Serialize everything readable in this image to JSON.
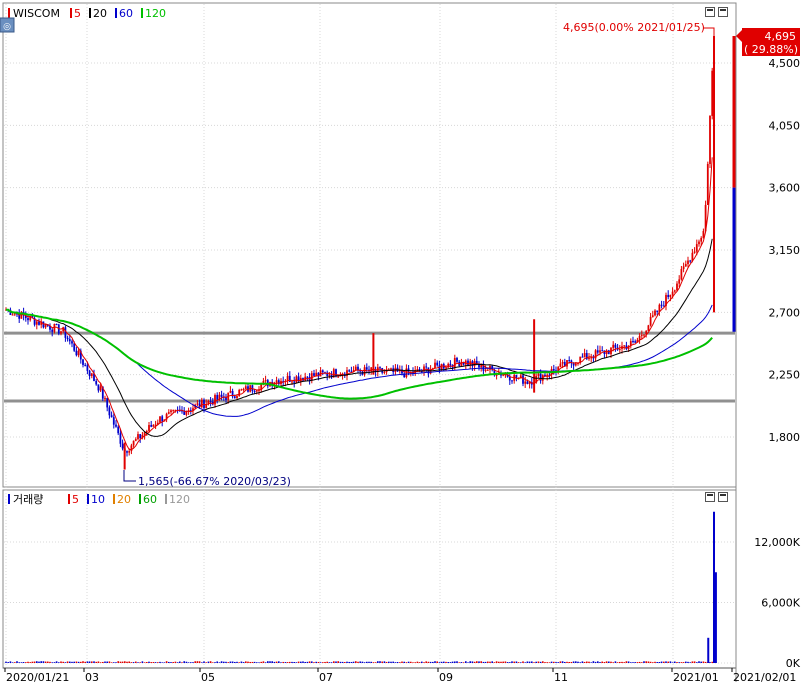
{
  "price_legend": {
    "symbol_icon": "red-bar-icon",
    "name": "WISCOM",
    "ma_items": [
      {
        "label": "5",
        "color": "#e00000"
      },
      {
        "label": "20",
        "color": "#000000"
      },
      {
        "label": "60",
        "color": "#0000cc"
      },
      {
        "label": "120",
        "color": "#00c000"
      }
    ]
  },
  "volume_legend": {
    "name": "거래량",
    "ma_items": [
      {
        "label": "5",
        "color": "#e00000"
      },
      {
        "label": "10",
        "color": "#0000cc"
      },
      {
        "label": "20",
        "color": "#e08000"
      },
      {
        "label": "60",
        "color": "#00a000"
      },
      {
        "label": "120",
        "color": "#999999"
      }
    ]
  },
  "annotations": {
    "max_note": "4,695(0.00% 2021/01/25)",
    "min_note": "1,565(-66.67% 2020/03/23)",
    "current_price": "4,695",
    "current_change": "( 29.88%)"
  },
  "chart_data": [
    {
      "type": "candlestick",
      "title": "WISCOM",
      "y_ticks": [
        "4,500",
        "4,050",
        "3,600",
        "3,150",
        "2,700",
        "2,250",
        "1,800"
      ],
      "ylim": [
        1570,
        4770
      ],
      "x_labels": [
        "2020/01/21",
        "03",
        "05",
        "07",
        "09",
        "11",
        "2021/01",
        "2021/02/01"
      ],
      "horizontal_lines": [
        2550,
        2060
      ],
      "key_points": [
        {
          "date": "2020/01/21",
          "close": 2720
        },
        {
          "date": "2020/02/20",
          "close": 2560
        },
        {
          "date": "2020/03/10",
          "close": 2150
        },
        {
          "date": "2020/03/23",
          "low": 1565,
          "close": 1700
        },
        {
          "date": "2020/04/10",
          "close": 1930
        },
        {
          "date": "2020/05/05",
          "close": 2050
        },
        {
          "date": "2020/06/10",
          "close": 2210
        },
        {
          "date": "2020/07/20",
          "close": 2280
        },
        {
          "date": "2020/08/20",
          "close": 2260
        },
        {
          "date": "2020/09/15",
          "close": 2350
        },
        {
          "date": "2020/10/20",
          "close": 2200
        },
        {
          "date": "2020/11/15",
          "close": 2360
        },
        {
          "date": "2020/12/15",
          "close": 2480
        },
        {
          "date": "2021/01/05",
          "close": 2900
        },
        {
          "date": "2021/01/20",
          "close": 3300
        },
        {
          "date": "2021/01/25",
          "high": 4695,
          "close": 4695
        }
      ],
      "moving_averages": [
        "5",
        "20",
        "60",
        "120"
      ],
      "grid": true
    },
    {
      "type": "bar",
      "title": "거래량",
      "y_ticks": [
        "12,000K",
        "6,000K",
        "0K"
      ],
      "ylim": [
        0,
        16000
      ],
      "spikes": [
        {
          "date": "2021/01/22",
          "value": 2500
        },
        {
          "date": "2021/01/25",
          "value": 15000
        },
        {
          "date": "2021/01/26",
          "value": 9000
        }
      ],
      "grid": true
    }
  ]
}
